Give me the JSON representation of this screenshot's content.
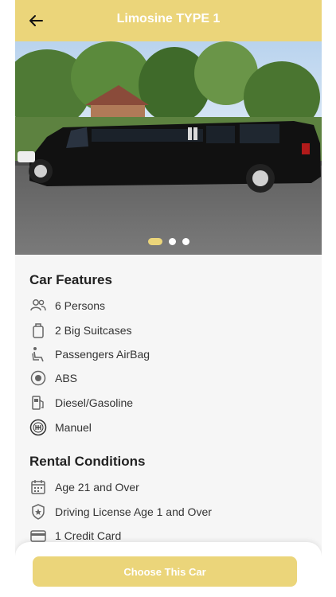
{
  "header": {
    "title": "Limosine TYPE 1"
  },
  "carousel": {
    "count": 3,
    "active": 0
  },
  "features": {
    "title": "Car Features",
    "items": [
      {
        "label": "6 Persons",
        "icon": "persons-icon"
      },
      {
        "label": "2 Big Suitcases",
        "icon": "suitcase-icon"
      },
      {
        "label": "Passengers AirBag",
        "icon": "airbag-seat-icon"
      },
      {
        "label": "ABS",
        "icon": "abs-icon"
      },
      {
        "label": "Diesel/Gasoline",
        "icon": "fuel-icon"
      },
      {
        "label": "Manuel",
        "icon": "gearbox-icon"
      }
    ]
  },
  "rental": {
    "title": "Rental Conditions",
    "items": [
      {
        "label": "Age 21 and Over",
        "icon": "calendar-icon"
      },
      {
        "label": "Driving License Age 1 and Over",
        "icon": "badge-star-icon"
      },
      {
        "label": "1 Credit Card",
        "icon": "credit-card-icon"
      }
    ]
  },
  "footer": {
    "cta_label": "Choose This Car"
  },
  "colors": {
    "accent": "#ebd57a",
    "background": "#f6f6f6"
  }
}
